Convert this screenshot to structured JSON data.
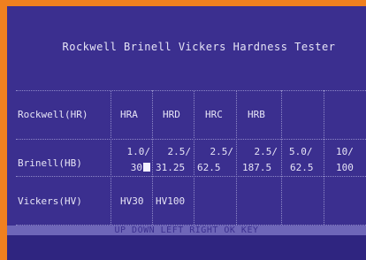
{
  "title": "Rockwell Brinell Vickers Hardness Tester",
  "rows": {
    "rockwell": {
      "label": "Rockwell(HR)",
      "values": [
        "HRA",
        "HRD",
        "HRC",
        "HRB"
      ]
    },
    "brinell": {
      "label": "Brinell(HB)",
      "values": [
        {
          "top": "1.0/",
          "bottom": "30"
        },
        {
          "top": "2.5/",
          "bottom": "31.25"
        },
        {
          "top": "2.5/",
          "bottom": "62.5"
        },
        {
          "top": "2.5/",
          "bottom": "187.5"
        },
        {
          "top": "5.0/",
          "bottom": "62.5"
        },
        {
          "top": "10/",
          "bottom": "100"
        }
      ]
    },
    "vickers": {
      "label": "Vickers(HV)",
      "values": [
        "HV30",
        "HV100"
      ]
    }
  },
  "footer": "UP DOWN LEFT RIGHT OK KEY",
  "colors": {
    "bezel": "#f0801f",
    "screen": "#3b2f8f",
    "text": "#e6e4f6",
    "footer_bar": "#6e66b8"
  }
}
